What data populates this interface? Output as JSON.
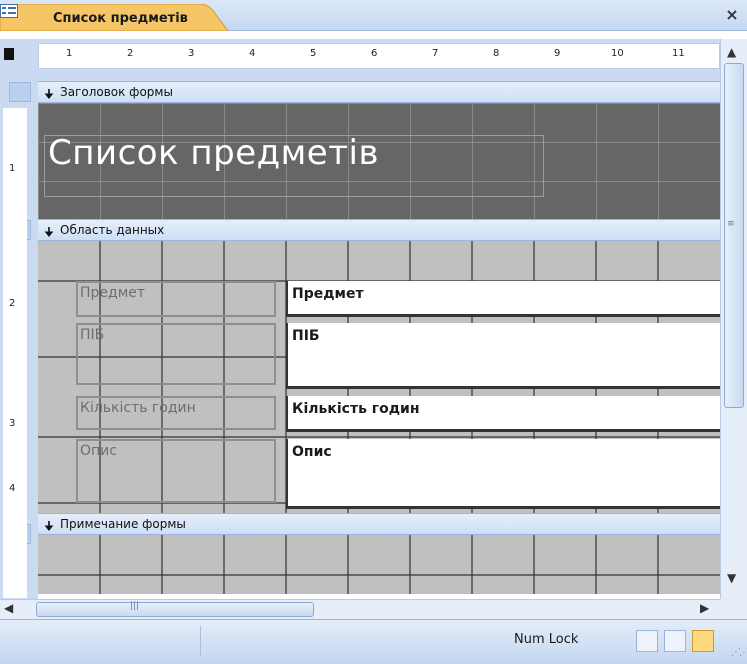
{
  "tab": {
    "title": "Список предметів",
    "icon": "form-icon"
  },
  "window": {
    "close_label": "×"
  },
  "ruler": {
    "h_ticks": [
      "1",
      "2",
      "3",
      "4",
      "5",
      "6",
      "7",
      "8",
      "9",
      "10",
      "11"
    ],
    "v_ticks": [
      "1",
      "2",
      "3",
      "4"
    ]
  },
  "sections": {
    "header": {
      "label": "Заголовок формы"
    },
    "detail": {
      "label": "Область данных"
    },
    "footer": {
      "label": "Примечание формы"
    }
  },
  "form": {
    "title": "Список предметів",
    "fields": [
      {
        "label": "Предмет",
        "control": "Предмет"
      },
      {
        "label": "ПІБ",
        "control": "ПІБ"
      },
      {
        "label": "Кількість годин",
        "control": "Кількість годин"
      },
      {
        "label": "Опис",
        "control": "Опис"
      }
    ]
  },
  "statusbar": {
    "num_lock": "Num Lock"
  },
  "colors": {
    "accent": "#f5a623",
    "header_bg": "#666666",
    "detail_bg": "#c0c0c0",
    "chrome": "#c9daf1"
  }
}
